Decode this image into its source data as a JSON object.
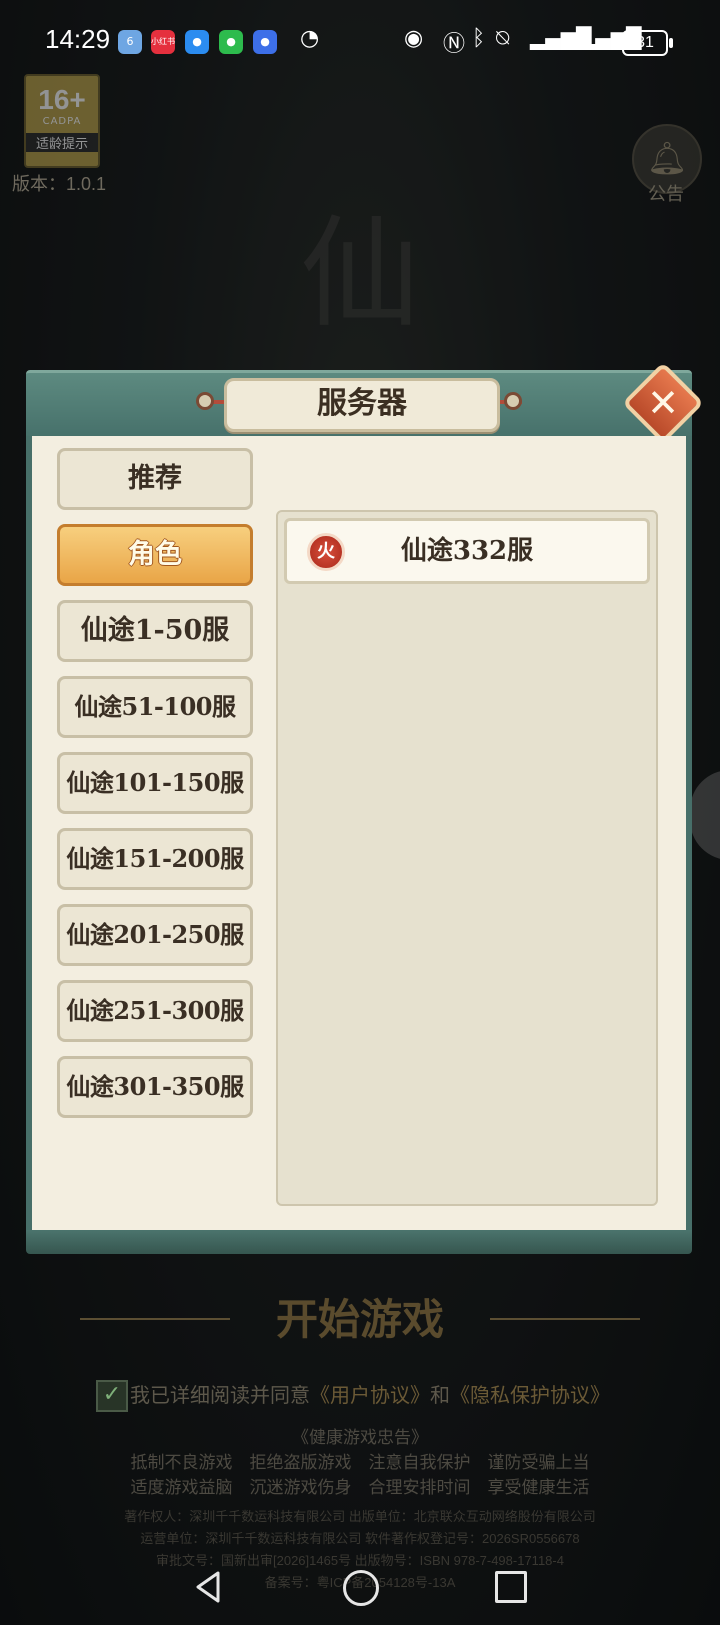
{
  "status_bar": {
    "time": "14:29",
    "apps": [
      {
        "name": "app-6-icon",
        "label": "6",
        "color": "#6ea6e3"
      },
      {
        "name": "xiaohongshu-icon",
        "label": "小红书",
        "color": "#e5303e"
      },
      {
        "name": "message-icon",
        "label": "●",
        "color": "#2b8cf0"
      },
      {
        "name": "wechat-icon",
        "label": "●",
        "color": "#2dbb4d"
      },
      {
        "name": "blue-app-icon",
        "label": "●",
        "color": "#3d6fe8"
      }
    ],
    "battery": "31"
  },
  "overlay": {
    "age_rating": "16+",
    "age_sub": "CADPA",
    "age_tip": "适龄提示",
    "version": "版本：1.0.1",
    "notice_label": "公告"
  },
  "background": {
    "title_glyph": "仙"
  },
  "dialog": {
    "title": "服务器",
    "tabs": [
      {
        "label": "推荐",
        "active": false
      },
      {
        "label": "角色",
        "active": true
      },
      {
        "label": "仙途1-50服",
        "active": false
      },
      {
        "label": "仙途51-100服",
        "active": false
      },
      {
        "label": "仙途101-150服",
        "active": false
      },
      {
        "label": "仙途151-200服",
        "active": false
      },
      {
        "label": "仙途201-250服",
        "active": false
      },
      {
        "label": "仙途251-300服",
        "active": false
      },
      {
        "label": "仙途301-350服",
        "active": false
      }
    ],
    "servers": [
      {
        "badge": "火",
        "name": "仙途332服"
      }
    ]
  },
  "bottom": {
    "start_label": "开始游戏",
    "agree_prefix": "我已详细阅读并同意",
    "user_agreement": "《用户协议》",
    "and": "和",
    "privacy_agreement": "《隐私保护协议》",
    "health_title": "《健康游戏忠告》",
    "health_line1": "抵制不良游戏　拒绝盗版游戏　注意自我保护　谨防受骗上当",
    "health_line2": "适度游戏益脑　沉迷游戏伤身　合理安排时间　享受健康生活",
    "copyright_line1": "著作权人：深圳千千数运科技有限公司  出版单位：北京联众互动网络股份有限公司",
    "copyright_line2": "运营单位：深圳千千数运科技有限公司  软件著作权登记号：2026SR0556678",
    "copyright_line3": "审批文号：国新出审[2026]1465号  出版物号：ISBN 978-7-498-17118-4",
    "copyright_line4": "备案号：粤ICP备2054128号-13A"
  }
}
